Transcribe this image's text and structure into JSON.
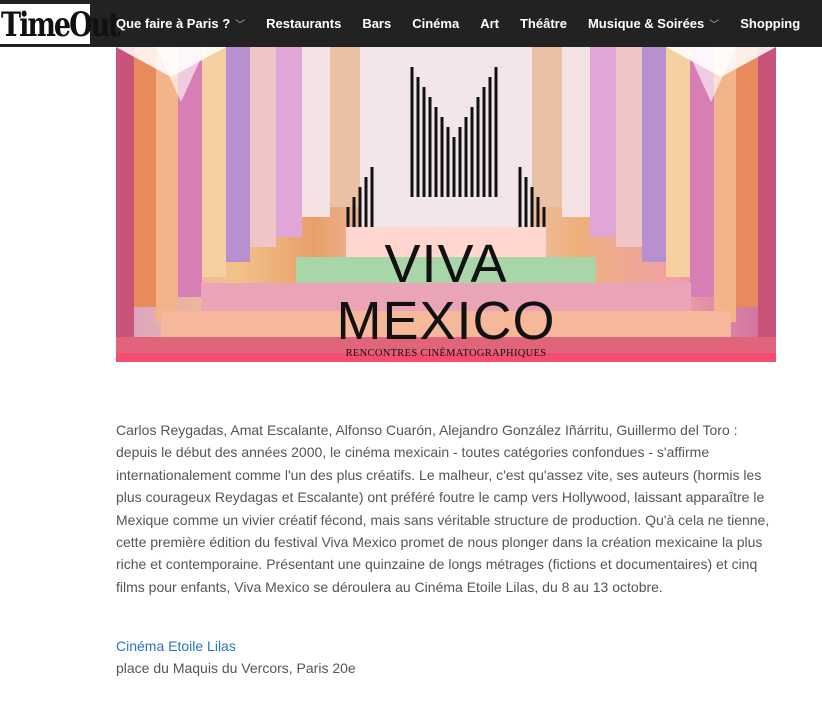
{
  "logo": {
    "text": "TimeOut"
  },
  "nav": [
    {
      "label": "Que faire à Paris ?",
      "dropdown": true
    },
    {
      "label": "Restaurants",
      "dropdown": false
    },
    {
      "label": "Bars",
      "dropdown": false
    },
    {
      "label": "Cinéma",
      "dropdown": false
    },
    {
      "label": "Art",
      "dropdown": false
    },
    {
      "label": "Théâtre",
      "dropdown": false
    },
    {
      "label": "Musique & Soirées",
      "dropdown": true
    },
    {
      "label": "Shopping",
      "dropdown": false
    }
  ],
  "hero": {
    "line1": "VIVA",
    "line2": "MEXICO",
    "subtitle": "RENCONTRES CINÉMATOGRAPHIQUES"
  },
  "article": {
    "body": "Carlos Reygadas, Amat Escalante, Alfonso Cuarón, Alejandro González Iñárritu, Guillermo del Toro : depuis le début des années 2000, le cinéma mexicain - toutes catégories confondues - s'affirme internationalement comme l'un des plus créatifs. Le malheur, c'est qu'assez vite, ses auteurs (hormis les plus courageux Reydagas et Escalante) ont préféré foutre le camp vers Hollywood, laissant apparaître le Mexique comme un vivier créatif fécond, mais sans véritable structure de production. Qu'à cela ne tienne, cette première édition du festival Viva Mexico promet de nous plonger dans la création mexicaine la plus riche et contemporaine. Présentant une quinzaine de longs métrages (fictions et documentaires) et cinq films pour enfants, Viva Mexico se déroulera au Cinéma Etoile Lilas, du 8 au 13 octobre."
  },
  "venue": {
    "name": "Cinéma Etoile Lilas",
    "address": "place du Maquis du Vercors, Paris 20e"
  },
  "colors": {
    "topbar": "#222222",
    "link": "#2e72c5",
    "text": "#555555"
  }
}
